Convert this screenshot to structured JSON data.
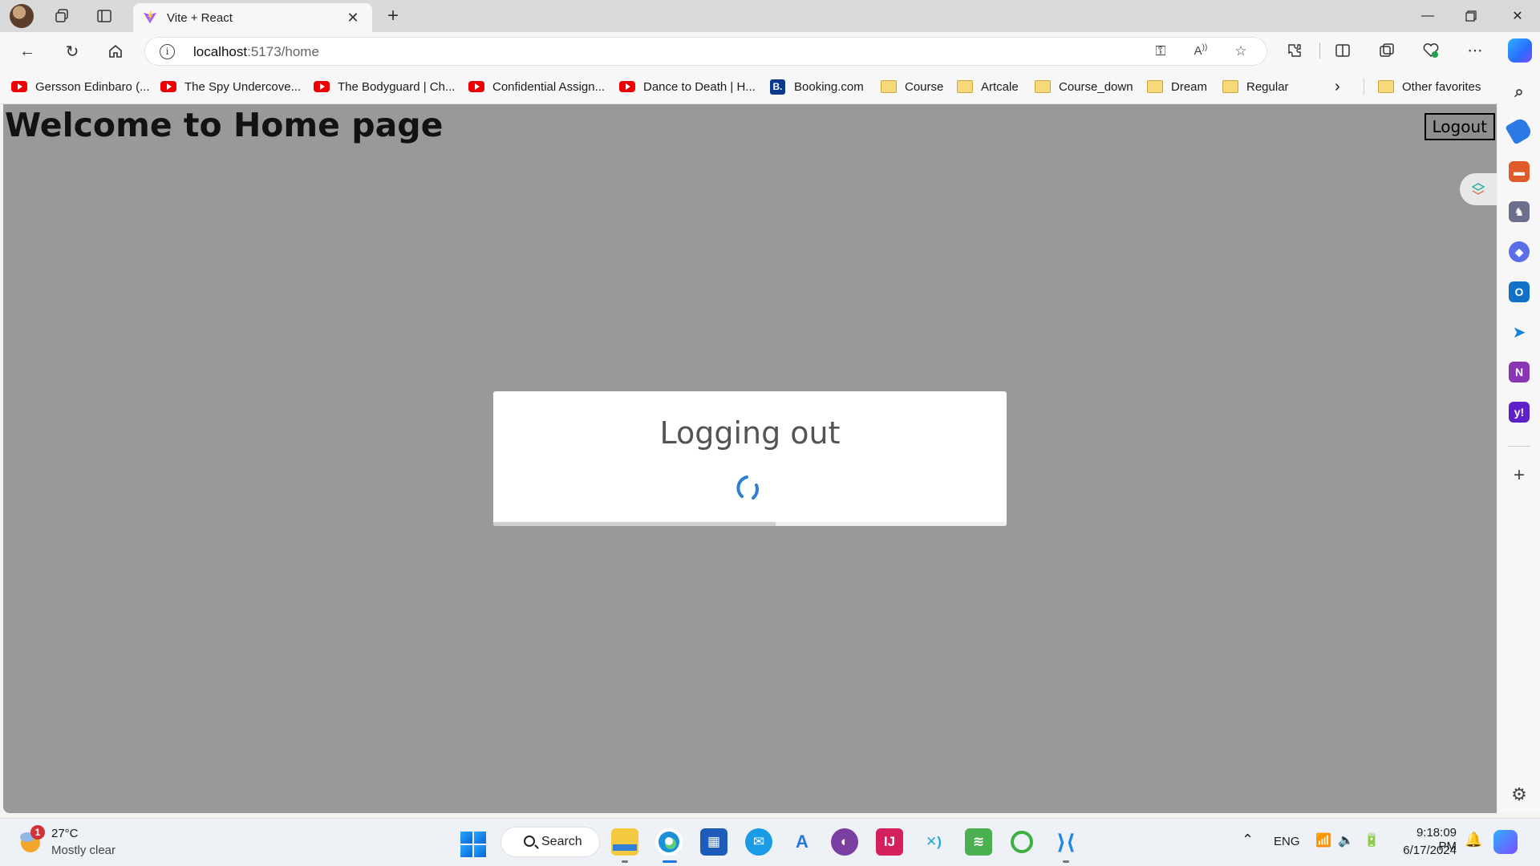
{
  "browser": {
    "tab": {
      "title": "Vite + React"
    },
    "address": {
      "host": "localhost",
      "path": ":5173/home"
    }
  },
  "favorites": [
    {
      "label": "Gersson Edinbaro (...",
      "icon": "youtube-icon"
    },
    {
      "label": "The Spy Undercove...",
      "icon": "youtube-icon"
    },
    {
      "label": "The Bodyguard | Ch...",
      "icon": "youtube-icon"
    },
    {
      "label": "Confidential Assign...",
      "icon": "youtube-icon"
    },
    {
      "label": "Dance to Death | H...",
      "icon": "youtube-icon"
    },
    {
      "label": "Booking.com",
      "icon": "booking-icon",
      "glyph": "B."
    },
    {
      "label": "Course",
      "icon": "folder-icon"
    },
    {
      "label": "Artcale",
      "icon": "folder-icon"
    },
    {
      "label": "Course_down",
      "icon": "folder-icon"
    },
    {
      "label": "Dream",
      "icon": "folder-icon"
    },
    {
      "label": "Regular",
      "icon": "folder-icon"
    }
  ],
  "other_favorites": "Other favorites",
  "page": {
    "heading": "Welcome to Home page",
    "logout_label": "Logout",
    "modal": {
      "title": "Logging out",
      "progress": 0.55
    }
  },
  "taskbar": {
    "weather": {
      "badge": "1",
      "temp": "27°C",
      "desc": "Mostly clear"
    },
    "search_label": "Search",
    "language": "ENG",
    "time": "9:18:09 PM",
    "date": "6/17/2024"
  },
  "colors": {
    "overlay": "#999999",
    "spinner": "#2d7fd3",
    "accent": "#1a73e8"
  }
}
